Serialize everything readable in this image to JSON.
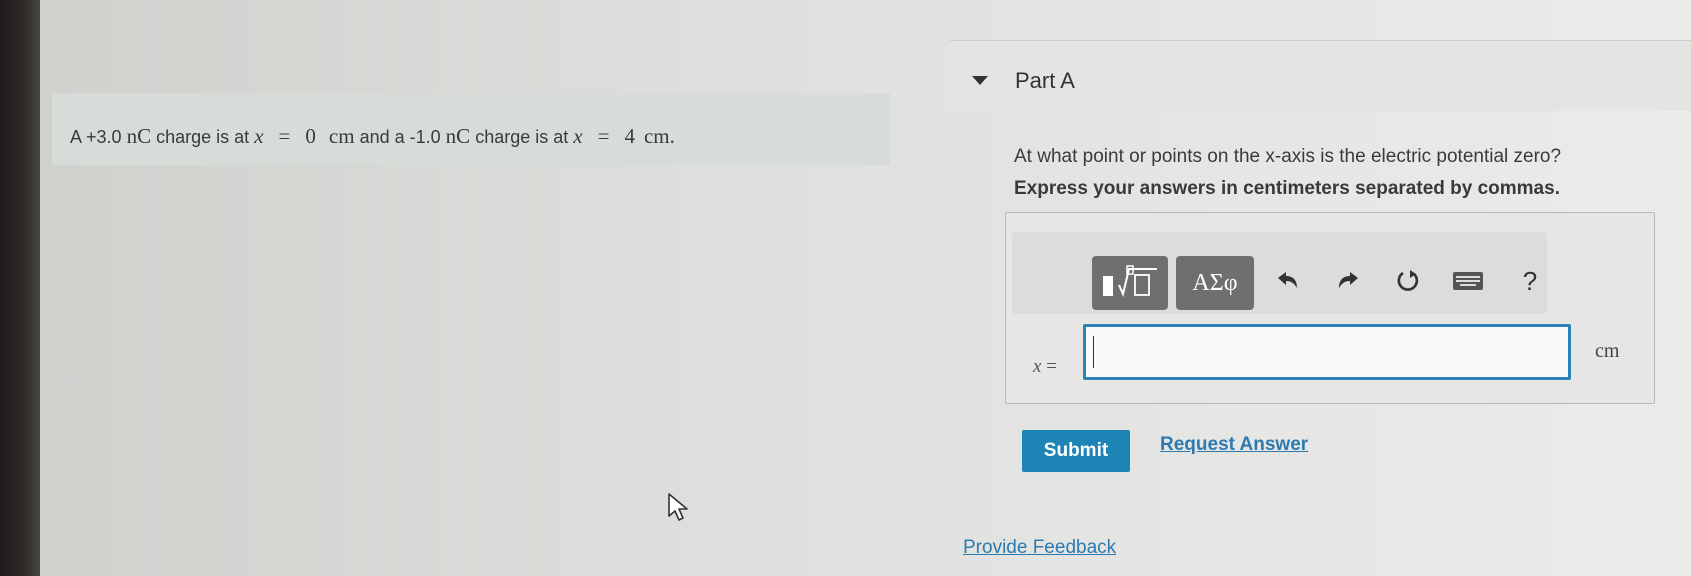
{
  "problem": {
    "prefix": "A +3.0",
    "charge1_unit": "nC",
    "mid1": "charge is at",
    "var1": "x",
    "eq1": "=",
    "pos1_value": "0",
    "pos1_unit": "cm",
    "mid2": "and a -1.0",
    "charge2_unit": "nC",
    "mid3": "charge is at",
    "var2": "x",
    "eq2": "=",
    "pos2_value": "4",
    "pos2_unit": "cm",
    "suffix": "."
  },
  "part": {
    "title": "Part A",
    "question": "At what point or points on the x-axis is the electric potential zero?",
    "instruction": "Express your answers in centimeters separated by commas."
  },
  "toolbar": {
    "symbols_label": "ΑΣφ",
    "help_label": "?"
  },
  "answer": {
    "variable": "x",
    "equals": "=",
    "value": "",
    "unit": "cm"
  },
  "actions": {
    "submit_label": "Submit",
    "request_label": "Request Answer",
    "feedback_label": "Provide Feedback"
  },
  "colors": {
    "accent": "#1e84b6",
    "link": "#2b7bb0",
    "problem_bg": "#d6ddd9",
    "input_border": "#2a84b8"
  }
}
